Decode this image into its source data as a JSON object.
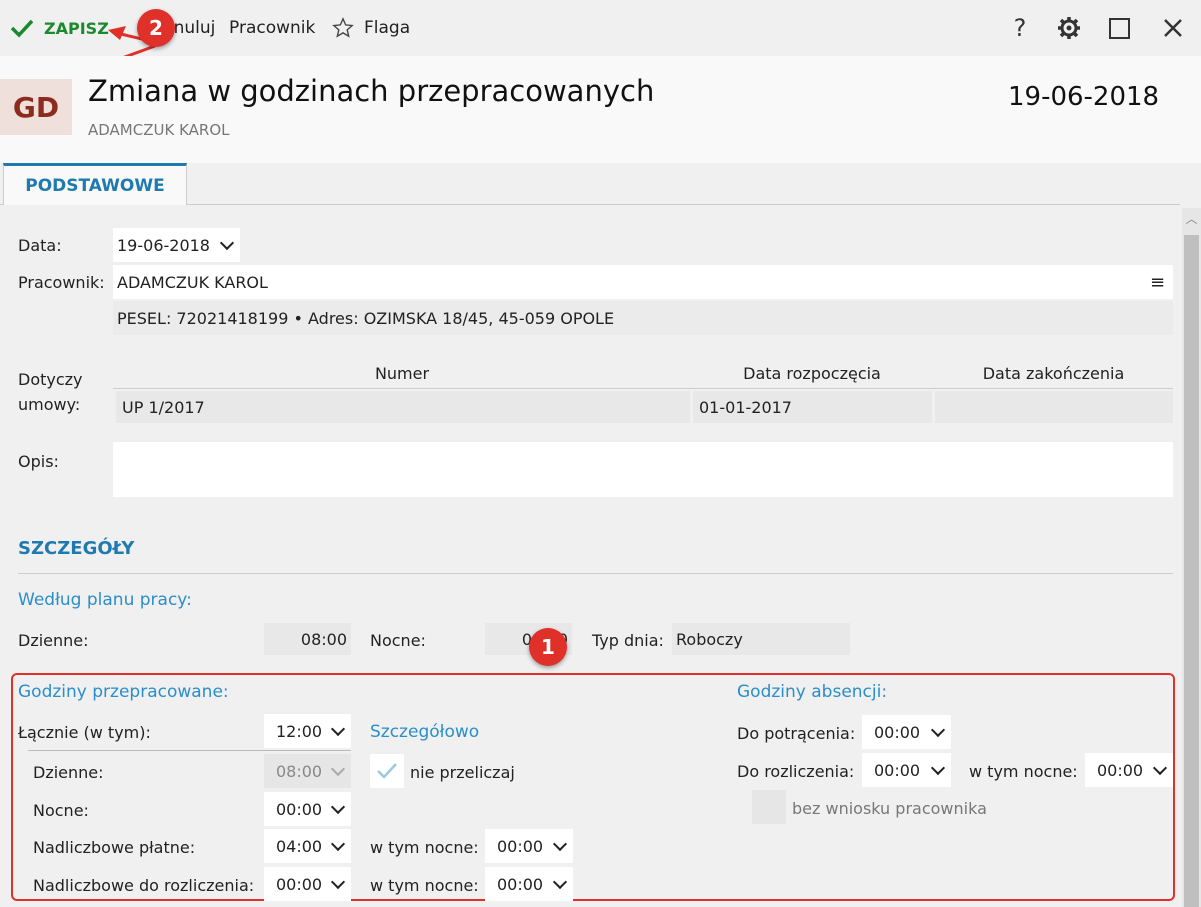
{
  "toolbar": {
    "save": "ZAPISZ",
    "cancel": "Anuluj",
    "employee": "Pracownik",
    "flag": "Flaga"
  },
  "header": {
    "avatar": "GD",
    "title": "Zmiana w godzinach przepracowanych",
    "subtitle": "ADAMCZUK KAROL",
    "date": "19-06-2018"
  },
  "tabs": {
    "basic": "PODSTAWOWE"
  },
  "form": {
    "date_label": "Data:",
    "date_value": "19-06-2018",
    "employee_label": "Pracownik:",
    "employee_value": "ADAMCZUK KAROL",
    "employee_info": "PESEL:  72021418199  •  Adres:  OZIMSKA 18/45, 45-059 OPOLE",
    "contract_label_1": "Dotyczy",
    "contract_label_2": "umowy:",
    "contract_headers": [
      "Numer",
      "Data rozpoczęcia",
      "Data zakończenia"
    ],
    "contract_row": [
      "UP 1/2017",
      "01-01-2017",
      ""
    ],
    "desc_label": "Opis:"
  },
  "details": {
    "section": "SZCZEGÓŁY",
    "plan_title": "Według planu pracy:",
    "day_label": "Dzienne:",
    "day_value": "08:00",
    "night_label": "Nocne:",
    "night_value": "00:00",
    "daytype_label": "Typ dnia:",
    "daytype_value": "Roboczy",
    "worked_title": "Godziny przepracowane:",
    "total_label": "Łącznie (w tym):",
    "total_value": "12:00",
    "detailed_link": "Szczegółowo",
    "w_day_label": "Dzienne:",
    "w_day_value": "08:00",
    "no_recalc": "nie przeliczaj",
    "w_night_label": "Nocne:",
    "w_night_value": "00:00",
    "ot_paid_label": "Nadliczbowe płatne:",
    "ot_paid_value": "04:00",
    "ot_paid_night_label": "w tym nocne:",
    "ot_paid_night_value": "00:00",
    "ot_settle_label": "Nadliczbowe do rozliczenia:",
    "ot_settle_value": "00:00",
    "ot_settle_night_label": "w tym nocne:",
    "ot_settle_night_value": "00:00",
    "absence_title": "Godziny absencji:",
    "deduct_label": "Do potrącenia:",
    "deduct_value": "00:00",
    "settle_label": "Do rozliczenia:",
    "settle_value": "00:00",
    "settle_night_label": "w tym nocne:",
    "settle_night_value": "00:00",
    "no_request": "bez wniosku pracownika"
  },
  "annotations": {
    "badge1": "1",
    "badge2": "2"
  },
  "colors": {
    "accent": "#1f7ab0",
    "save": "#1a8a2e",
    "highlight": "#e0302a"
  }
}
